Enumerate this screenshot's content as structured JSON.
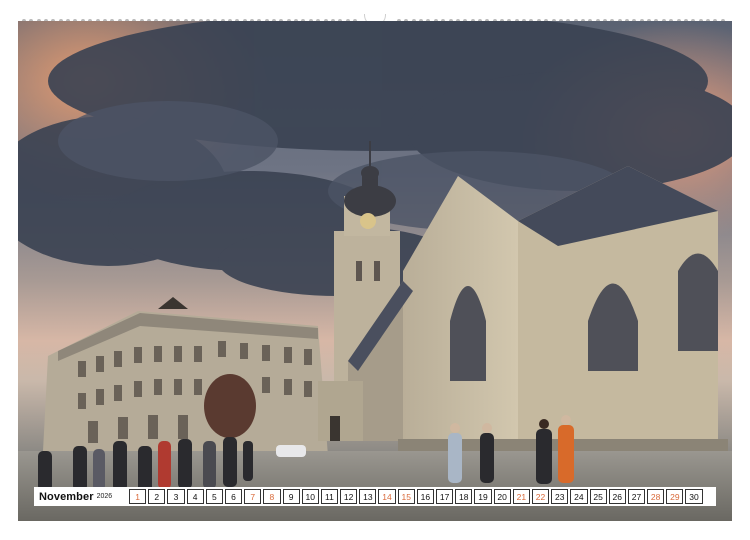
{
  "calendar": {
    "month": "November",
    "year": "2026",
    "days": [
      "1",
      "2",
      "3",
      "4",
      "5",
      "6",
      "7",
      "8",
      "9",
      "10",
      "11",
      "12",
      "13",
      "14",
      "15",
      "16",
      "17",
      "18",
      "19",
      "20",
      "21",
      "22",
      "23",
      "24",
      "25",
      "26",
      "27",
      "28",
      "29",
      "30"
    ],
    "weekend_days": [
      "1",
      "7",
      "8",
      "14",
      "15",
      "21",
      "22",
      "28",
      "29"
    ]
  },
  "colors": {
    "weekend_text": "#d96a3a",
    "weekday_text": "#111111",
    "day_border": "#333333"
  }
}
